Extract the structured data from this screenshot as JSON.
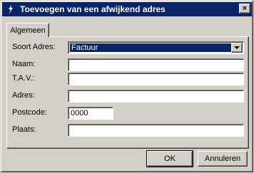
{
  "window": {
    "title": "Toevoegen van een afwijkend adres",
    "close_label": "×",
    "icon": "app-icon"
  },
  "tabs": [
    {
      "label": "Algemeen",
      "active": true
    }
  ],
  "form": {
    "soort_adres": {
      "label": "Soort Adres:",
      "value": "Factuur"
    },
    "naam": {
      "label": "Naam:",
      "value": ""
    },
    "tav": {
      "label": "T.A.V.:",
      "value": ""
    },
    "adres": {
      "label": "Adres:",
      "value": ""
    },
    "postcode": {
      "label": "Postcode:",
      "value": "0000"
    },
    "plaats": {
      "label": "Plaats:",
      "value": ""
    }
  },
  "buttons": {
    "ok": "OK",
    "cancel": "Annuleren"
  },
  "colors": {
    "titlebar": "#0a246a",
    "face": "#d4d0c8",
    "selection": "#0a246a"
  }
}
